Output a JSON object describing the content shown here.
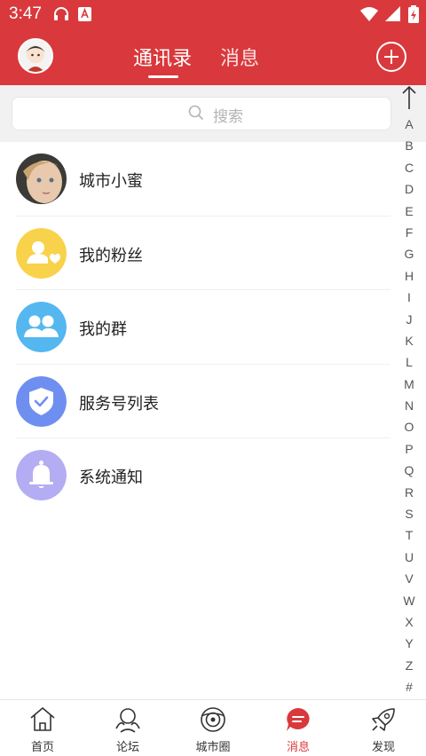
{
  "status_bar": {
    "time": "3:47"
  },
  "header": {
    "tabs": [
      {
        "label": "通讯录",
        "active": true
      },
      {
        "label": "消息",
        "active": false
      }
    ]
  },
  "search": {
    "placeholder": "搜索"
  },
  "contacts": [
    {
      "label": "城市小蜜",
      "icon": "user-photo-icon"
    },
    {
      "label": "我的粉丝",
      "icon": "user-heart-icon",
      "color": "#f8d24a"
    },
    {
      "label": "我的群",
      "icon": "group-icon",
      "color": "#55b7ef"
    },
    {
      "label": "服务号列表",
      "icon": "shield-check-icon",
      "color": "#6f8ff0"
    },
    {
      "label": "系统通知",
      "icon": "bell-icon",
      "color": "#b4adf3"
    }
  ],
  "index_bar": {
    "letters": [
      "A",
      "B",
      "C",
      "D",
      "E",
      "F",
      "G",
      "H",
      "I",
      "J",
      "K",
      "L",
      "M",
      "N",
      "O",
      "P",
      "Q",
      "R",
      "S",
      "T",
      "U",
      "V",
      "W",
      "X",
      "Y",
      "Z",
      "#"
    ]
  },
  "bottom_nav": [
    {
      "label": "首页",
      "icon": "home-icon"
    },
    {
      "label": "论坛",
      "icon": "forum-icon"
    },
    {
      "label": "城市圈",
      "icon": "city-circle-icon"
    },
    {
      "label": "消息",
      "icon": "message-icon",
      "active": true
    },
    {
      "label": "发现",
      "icon": "rocket-icon"
    }
  ],
  "colors": {
    "primary": "#d9393c"
  }
}
